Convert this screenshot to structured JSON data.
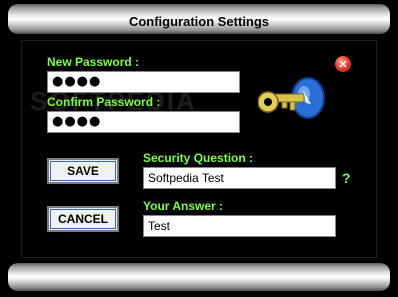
{
  "window": {
    "title": "Configuration Settings"
  },
  "form": {
    "new_password_label": "New Password :",
    "new_password_value": "●●●●",
    "confirm_password_label": "Confirm Password :",
    "confirm_password_value": "●●●●",
    "security_question_label": "Security Question :",
    "security_question_value": "Softpedia Test",
    "your_answer_label": "Your Answer :",
    "your_answer_value": "Test"
  },
  "buttons": {
    "save": "SAVE",
    "cancel": "CANCEL",
    "close": "✕",
    "help": "?"
  },
  "watermark": "SOFTPEDIA",
  "colors": {
    "label": "#7CFF3A",
    "close": "#e8351f",
    "key": "#d9c24a",
    "lock": "#2a6fd6"
  },
  "icons": {
    "close": "close-icon",
    "keys": "keys-icon",
    "help": "help-icon"
  }
}
